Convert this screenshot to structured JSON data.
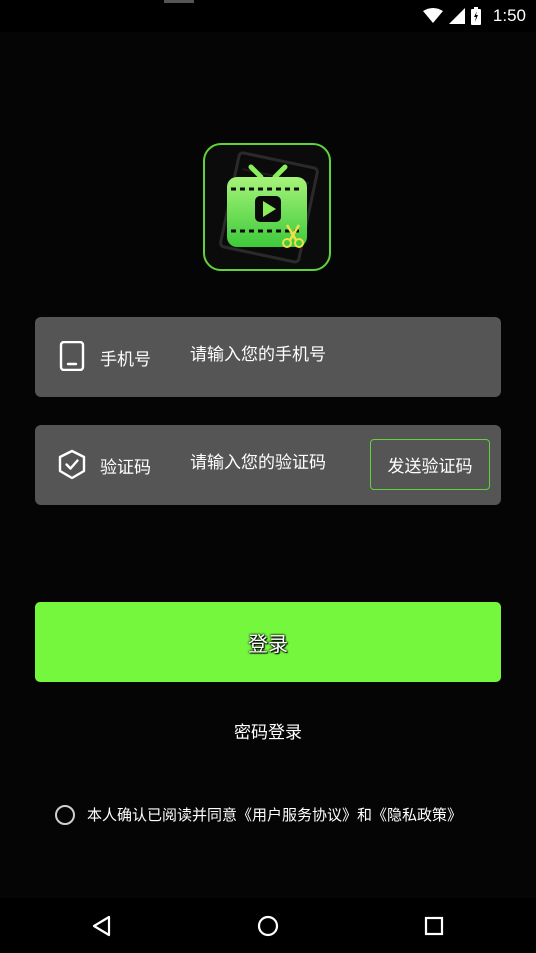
{
  "status_bar": {
    "time": "1:50",
    "icons": [
      "wifi-icon",
      "signal-icon",
      "battery-icon"
    ]
  },
  "app": {
    "logo_icon": "video-editor-logo-icon",
    "accent_color": "#74f73c",
    "border_accent": "#5fd33a"
  },
  "phone_field": {
    "icon": "phone-icon",
    "label": "手机号",
    "placeholder": "请输入您的手机号",
    "value": ""
  },
  "code_field": {
    "icon": "shield-check-icon",
    "label": "验证码",
    "placeholder": "请输入您的验证码",
    "value": "",
    "send_button": "发送验证码"
  },
  "login_button": "登录",
  "password_login": "密码登录",
  "agreement": {
    "prefix": "本人确认已阅读并同意",
    "user_agreement": "《用户服务协议》",
    "conjunction": "和",
    "privacy_policy": "《隐私政策》",
    "checked": false
  },
  "nav_bar": {
    "icons": [
      "back-icon",
      "home-icon",
      "recent-apps-icon"
    ]
  }
}
